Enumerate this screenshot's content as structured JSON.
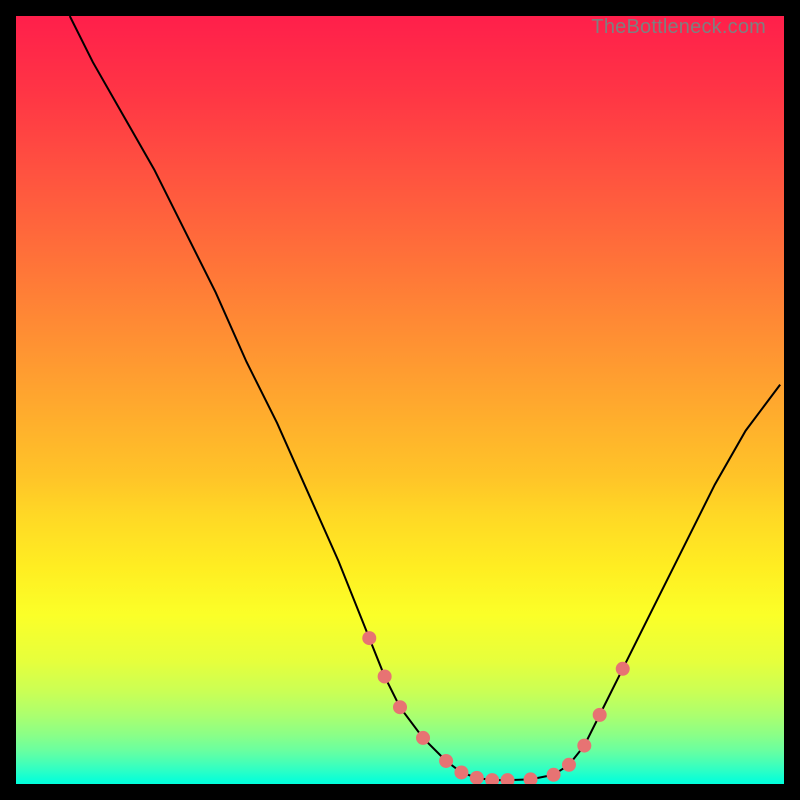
{
  "watermark": "TheBottleneck.com",
  "chart_data": {
    "type": "line",
    "title": "",
    "xlabel": "",
    "ylabel": "",
    "xlim": [
      0,
      100
    ],
    "ylim": [
      0,
      100
    ],
    "background_gradient": {
      "stops": [
        {
          "offset": 0.0,
          "color": "#ff1f4b"
        },
        {
          "offset": 0.1,
          "color": "#ff3545"
        },
        {
          "offset": 0.2,
          "color": "#ff5140"
        },
        {
          "offset": 0.3,
          "color": "#ff6d3a"
        },
        {
          "offset": 0.4,
          "color": "#ff8a34"
        },
        {
          "offset": 0.5,
          "color": "#ffa72e"
        },
        {
          "offset": 0.6,
          "color": "#ffc428"
        },
        {
          "offset": 0.65,
          "color": "#ffd825"
        },
        {
          "offset": 0.72,
          "color": "#ffee22"
        },
        {
          "offset": 0.78,
          "color": "#fbff28"
        },
        {
          "offset": 0.84,
          "color": "#e6ff3c"
        },
        {
          "offset": 0.88,
          "color": "#caff55"
        },
        {
          "offset": 0.91,
          "color": "#acff6e"
        },
        {
          "offset": 0.935,
          "color": "#8cff86"
        },
        {
          "offset": 0.955,
          "color": "#6cff9e"
        },
        {
          "offset": 0.97,
          "color": "#4bffb3"
        },
        {
          "offset": 0.983,
          "color": "#2bffc6"
        },
        {
          "offset": 0.992,
          "color": "#12ffd3"
        },
        {
          "offset": 1.0,
          "color": "#00ffdc"
        }
      ]
    },
    "series": [
      {
        "name": "bottleneck-curve",
        "color": "#000000",
        "x": [
          7,
          10,
          14,
          18,
          22,
          26,
          30,
          34,
          38,
          42,
          46,
          48,
          50,
          53,
          56,
          58,
          60,
          62,
          64,
          67,
          70,
          72,
          74,
          76,
          79,
          83,
          87,
          91,
          95,
          99.5
        ],
        "y_pct": [
          100,
          94,
          87,
          80,
          72,
          64,
          55,
          47,
          38,
          29,
          19,
          14,
          10,
          6,
          3,
          1.5,
          0.8,
          0.5,
          0.5,
          0.6,
          1.2,
          2.5,
          5,
          9,
          15,
          23,
          31,
          39,
          46,
          52
        ]
      }
    ],
    "markers": {
      "name": "highlight-dots",
      "color": "#e77373",
      "radius": 7,
      "x": [
        46,
        48,
        50,
        53,
        56,
        58,
        60,
        62,
        64,
        67,
        70,
        72,
        74,
        76,
        79
      ],
      "y_pct": [
        19,
        14,
        10,
        6,
        3,
        1.5,
        0.8,
        0.5,
        0.5,
        0.6,
        1.2,
        2.5,
        5,
        9,
        15
      ]
    }
  }
}
